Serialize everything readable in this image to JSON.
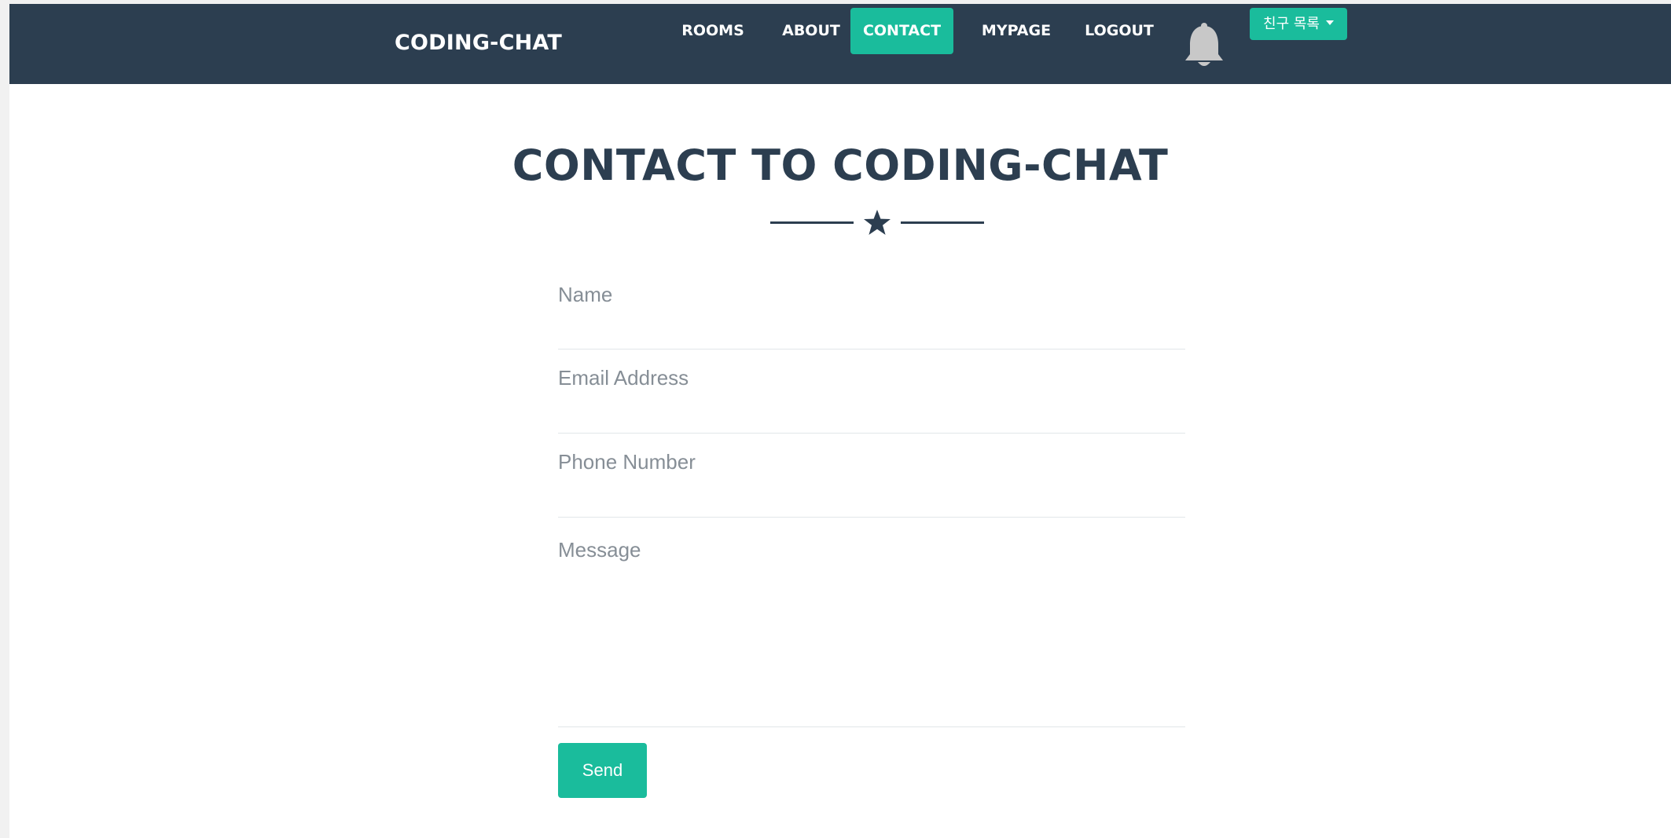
{
  "navbar": {
    "brand": "CODING-CHAT",
    "items": [
      {
        "label": "ROOMS",
        "active": false
      },
      {
        "label": "ABOUT",
        "active": false
      },
      {
        "label": "CONTACT",
        "active": true
      },
      {
        "label": "MYPAGE",
        "active": false
      },
      {
        "label": "LOGOUT",
        "active": false
      }
    ],
    "notification_icon": "bell-icon",
    "friends_dropdown_label": "친구 목록"
  },
  "main": {
    "title": "CONTACT TO CODING-CHAT",
    "divider_icon": "star-icon",
    "form": {
      "name_placeholder": "Name",
      "email_placeholder": "Email Address",
      "phone_placeholder": "Phone Number",
      "message_placeholder": "Message",
      "send_label": "Send"
    }
  },
  "colors": {
    "navbar_bg": "#2c3e50",
    "accent": "#1abc9c",
    "title": "#2c3e50",
    "placeholder": "#868e96"
  }
}
